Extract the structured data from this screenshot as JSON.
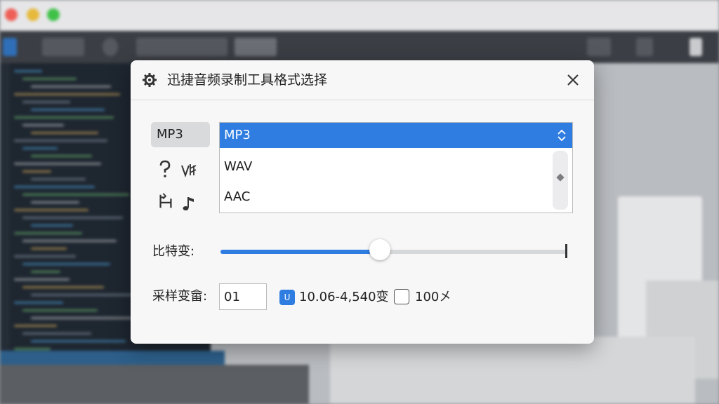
{
  "dialog": {
    "title": "迅捷音频录制工具格式选择",
    "format_chip": "MP3",
    "options": [
      {
        "label": "MP3",
        "selected": true
      },
      {
        "label": "WAV",
        "selected": false
      },
      {
        "label": "AAC",
        "selected": false
      }
    ],
    "bitrate_label": "比特变:",
    "bitrate_level": 0.46,
    "samplerate_label": "采样变畲:",
    "samplerate_value": "01",
    "check1_glyph": "U",
    "check1_label": "10.06-4,540变",
    "check1_checked": true,
    "check2_label": "100㐅",
    "check2_checked": false
  },
  "colors": {
    "accent": "#2f7de1",
    "dialog_bg": "#f7f7f8",
    "chip_bg": "#d9dadc"
  },
  "icons": [
    "gear-icon",
    "close-icon",
    "question-icon",
    "music-note-icon",
    "chair-icon",
    "chevron-updown-icon"
  ]
}
